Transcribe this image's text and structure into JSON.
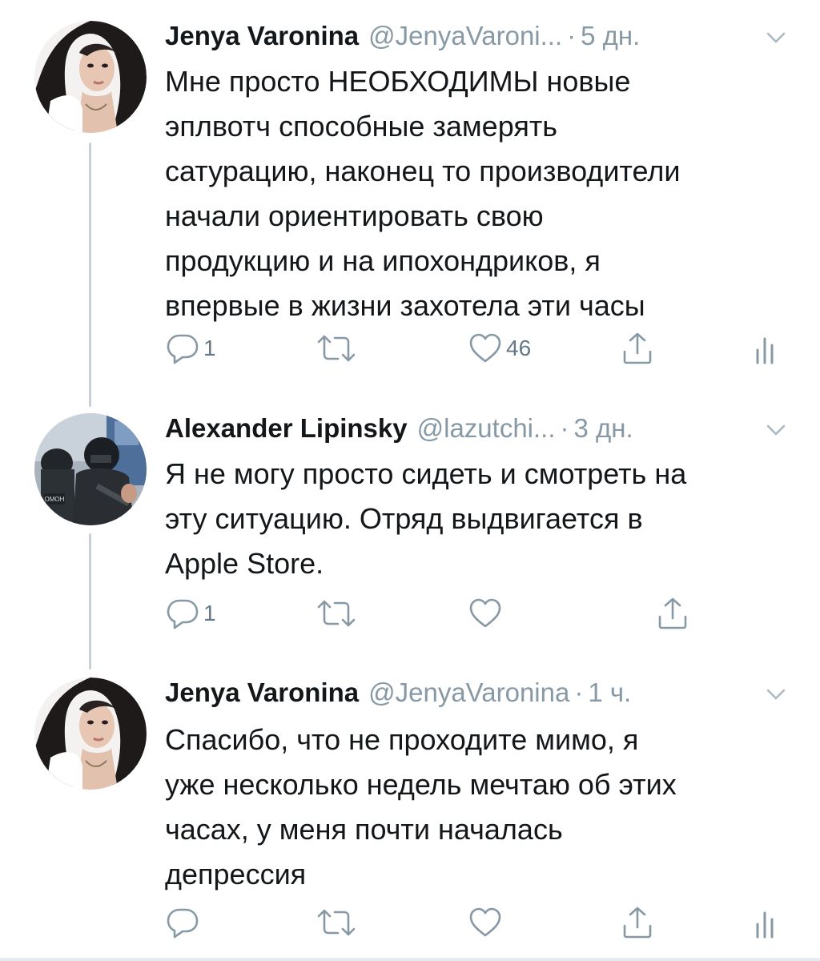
{
  "thread": {
    "tweets": [
      {
        "display_name": "Jenya Varonina",
        "handle": "@JenyaVaroni...",
        "separator": "·",
        "time": "5 дн.",
        "avatar_icon": "avatar-woman-photo",
        "lines": [
          "Мне просто НЕОБХОДИМЫ новые",
          "эплвотч способные замерять",
          "сатурацию, наконец то производители",
          "начали ориентировать свою",
          "продукцию и на ипохондриков, я",
          "впервые в жизни захотела эти часы"
        ],
        "reply_count": "1",
        "retweet_count": "",
        "like_count": "46"
      },
      {
        "display_name": "Alexander Lipinsky",
        "handle": "@lazutchi...",
        "separator": "·",
        "time": "3 дн.",
        "avatar_icon": "avatar-riot-police-photo",
        "avatar_badge": "ОМОН",
        "lines": [
          "Я не могу просто сидеть и смотреть на",
          "эту ситуацию. Отряд выдвигается в",
          "Apple Store."
        ],
        "reply_count": "1",
        "retweet_count": "",
        "like_count": ""
      },
      {
        "display_name": "Jenya Varonina",
        "handle": "@JenyaVaronina",
        "separator": "·",
        "time": "1 ч.",
        "avatar_icon": "avatar-woman-photo",
        "lines": [
          "Спасибо, что не проходите мимо, я",
          "уже несколько недель мечтаю об этих",
          "часах, у меня почти началась",
          "депрессия"
        ],
        "reply_count": "",
        "retweet_count": "",
        "like_count": ""
      }
    ]
  },
  "icons": {
    "reply": "reply-icon",
    "retweet": "retweet-icon",
    "like": "heart-icon",
    "share": "share-icon",
    "analytics": "analytics-icon",
    "more": "chevron-down-icon"
  },
  "colors": {
    "text": "#14171a",
    "secondary": "#8899a6",
    "thread_line": "#c7d0d8",
    "divider": "#e6ecf0"
  }
}
